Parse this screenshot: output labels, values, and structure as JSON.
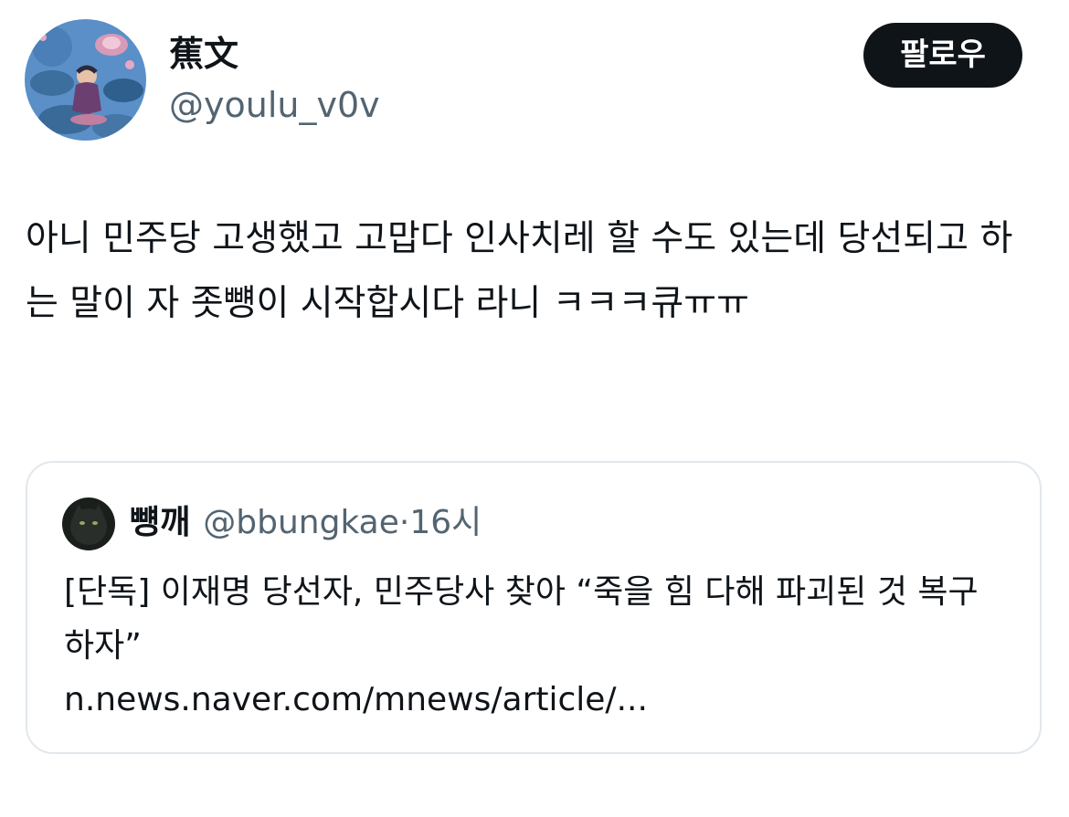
{
  "author": {
    "display_name": "蕉文",
    "handle": "@youlu_v0v"
  },
  "follow_button": {
    "label": "팔로우"
  },
  "tweet": {
    "text": "아니 민주당 고생했고 고맙다 인사치레 할 수도 있는데 당선되고 하는 말이 자 좃뻉이 시작합시다 라니 ㅋㅋㅋ큐ㅠㅠ"
  },
  "quoted_tweet": {
    "display_name": "뻉깨",
    "handle": "@bbungkae",
    "separator": "·",
    "time": "16시",
    "text": "[단독] 이재명 당선자, 민주당사 찾아 “죽을 힘 다해 파괴된 것 복구하자”",
    "link": "n.news.naver.com/mnews/article/..."
  },
  "colors": {
    "text_primary": "#0f1419",
    "text_secondary": "#536471",
    "follow_bg": "#0f1419",
    "border": "#e1e8ed"
  },
  "icons": {
    "author_avatar": "lotus-pond-illustration-avatar",
    "quoted_avatar": "dark-cat-avatar"
  }
}
